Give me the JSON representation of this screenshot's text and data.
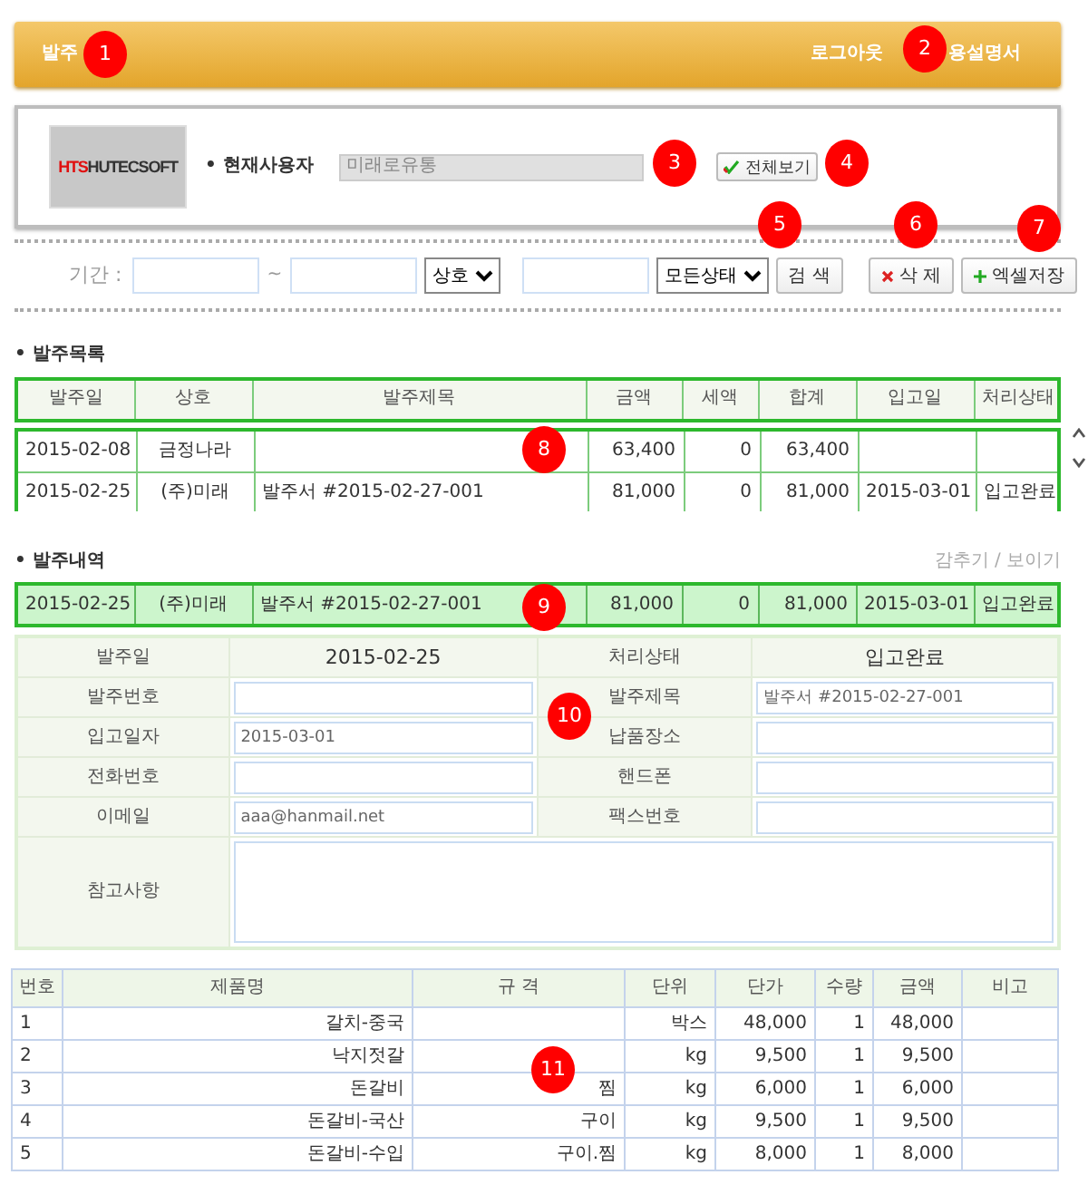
{
  "header": {
    "title": "발주",
    "links": [
      "로그아웃",
      "용설명서"
    ]
  },
  "logo": {
    "mark": "HTS",
    "name": "HUTECSOFT"
  },
  "user": {
    "label": "• 현재사용자",
    "value": "미래로유통",
    "view_all_button": "전체보기"
  },
  "search": {
    "period_label": "기간 :",
    "separator": "~",
    "company_select": "상호",
    "status_select": "모든상태",
    "search_button": "검 색",
    "delete_button": "삭 제",
    "excel_button": "엑셀저장"
  },
  "order_list": {
    "title": "• 발주목록",
    "columns": [
      "발주일",
      "상호",
      "발주제목",
      "금액",
      "세액",
      "합계",
      "입고일",
      "처리상태"
    ],
    "rows": [
      {
        "cells": [
          "2015-02-08",
          "금정나라",
          "",
          "63,400",
          "0",
          "63,400",
          "",
          ""
        ]
      },
      {
        "cells": [
          "2015-02-25",
          "(주)미래",
          "발주서 #2015-02-27-001",
          "81,000",
          "0",
          "81,000",
          "2015-03-01",
          "입고완료"
        ]
      }
    ]
  },
  "order_detail": {
    "title": "• 발주내역",
    "toggle": "감추기 / 보이기",
    "selected_row": [
      "2015-02-25",
      "(주)미래",
      "발주서 #2015-02-27-001",
      "81,000",
      "0",
      "81,000",
      "2015-03-01",
      "입고완료"
    ]
  },
  "form": {
    "fields": [
      {
        "label": "발주일",
        "value": "2015-02-25",
        "kind": "text"
      },
      {
        "label": "처리상태",
        "value": "입고완료",
        "kind": "text"
      },
      {
        "label": "발주번호",
        "kind": "input"
      },
      {
        "label": "발주제목",
        "value": "발주서 #2015-02-27-001",
        "kind": "input"
      },
      {
        "label": "입고일자",
        "value": "2015-03-01",
        "kind": "input"
      },
      {
        "label": "납품장소",
        "kind": "input"
      },
      {
        "label": "전화번호",
        "kind": "input"
      },
      {
        "label": "핸드폰",
        "kind": "input"
      },
      {
        "label": "이메일",
        "value": "aaa@hanmail.net",
        "kind": "input"
      },
      {
        "label": "팩스번호",
        "kind": "input"
      },
      {
        "label": "참고사항",
        "kind": "textarea"
      }
    ]
  },
  "products": {
    "columns": [
      "번호",
      "제품명",
      "규 격",
      "단위",
      "단가",
      "수량",
      "금액",
      "비고"
    ],
    "rows": [
      [
        "1",
        "갈치-중국",
        "",
        "박스",
        "48,000",
        "1",
        "48,000",
        ""
      ],
      [
        "2",
        "낙지젓갈",
        "",
        "kg",
        "9,500",
        "1",
        "9,500",
        ""
      ],
      [
        "3",
        "돈갈비",
        "찜",
        "kg",
        "6,000",
        "1",
        "6,000",
        ""
      ],
      [
        "4",
        "돈갈비-국산",
        "구이",
        "kg",
        "9,500",
        "1",
        "9,500",
        ""
      ],
      [
        "5",
        "돈갈비-수입",
        "구이.찜",
        "kg",
        "8,000",
        "1",
        "8,000",
        ""
      ]
    ]
  },
  "markers": [
    "1",
    "2",
    "3",
    "4",
    "5",
    "6",
    "7",
    "8",
    "9",
    "10",
    "11"
  ]
}
